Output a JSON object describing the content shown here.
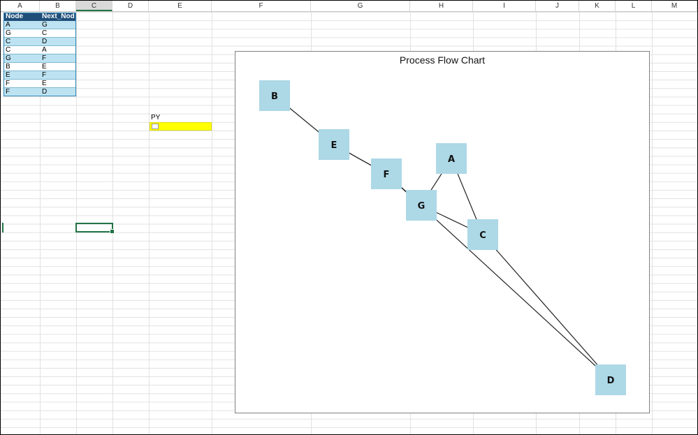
{
  "columns": [
    "A",
    "B",
    "C",
    "D",
    "E",
    "F",
    "G",
    "H",
    "I",
    "J",
    "K",
    "L",
    "M"
  ],
  "active_column": "C",
  "table": {
    "headers": [
      "Node",
      "Next_Nod"
    ],
    "rows": [
      [
        "A",
        "G"
      ],
      [
        "G",
        "C"
      ],
      [
        "C",
        "D"
      ],
      [
        "C",
        "A"
      ],
      [
        "G",
        "F"
      ],
      [
        "B",
        "E"
      ],
      [
        "E",
        "F"
      ],
      [
        "F",
        "E"
      ],
      [
        "F",
        "D"
      ]
    ]
  },
  "py_label": "PY",
  "colors": {
    "header_fill": "#1f4e79",
    "band_fill": "#bde3f2",
    "py_fill": "#ffff00",
    "node_fill": "#add8e6",
    "selection": "#217346"
  },
  "chart": {
    "title": "Process Flow Chart",
    "nodes": [
      {
        "id": "B",
        "label": "B"
      },
      {
        "id": "E",
        "label": "E"
      },
      {
        "id": "F",
        "label": "F"
      },
      {
        "id": "A",
        "label": "A"
      },
      {
        "id": "G",
        "label": "G"
      },
      {
        "id": "C",
        "label": "C"
      },
      {
        "id": "D",
        "label": "D"
      }
    ],
    "edges": [
      [
        "A",
        "G"
      ],
      [
        "G",
        "C"
      ],
      [
        "C",
        "D"
      ],
      [
        "C",
        "A"
      ],
      [
        "G",
        "F"
      ],
      [
        "B",
        "E"
      ],
      [
        "E",
        "F"
      ],
      [
        "F",
        "E"
      ],
      [
        "F",
        "D"
      ]
    ]
  }
}
